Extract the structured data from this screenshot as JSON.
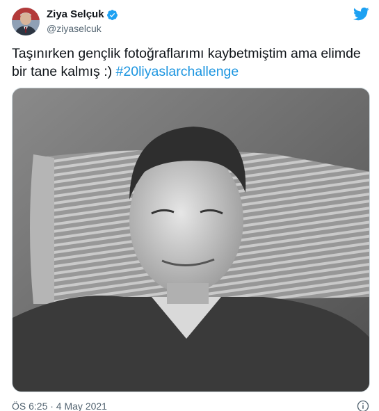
{
  "author": {
    "display_name": "Ziya Selçuk",
    "handle": "@ziyaselcuk",
    "verified": true
  },
  "tweet": {
    "text_before": "Taşınırken gençlik fotoğraflarımı kaybetmiştim ama elimde bir tane kalmış :) ",
    "hashtag": "#20liyaslarchallenge",
    "timestamp": "ÖS 6:25 · 4 May 2021"
  },
  "icons": {
    "platform": "twitter-bird-icon",
    "verified": "verified-badge-icon",
    "info": "info-icon"
  },
  "colors": {
    "brand": "#1da1f2",
    "hashtag": "#1b95e0",
    "text": "#0f1419",
    "muted": "#536471"
  }
}
